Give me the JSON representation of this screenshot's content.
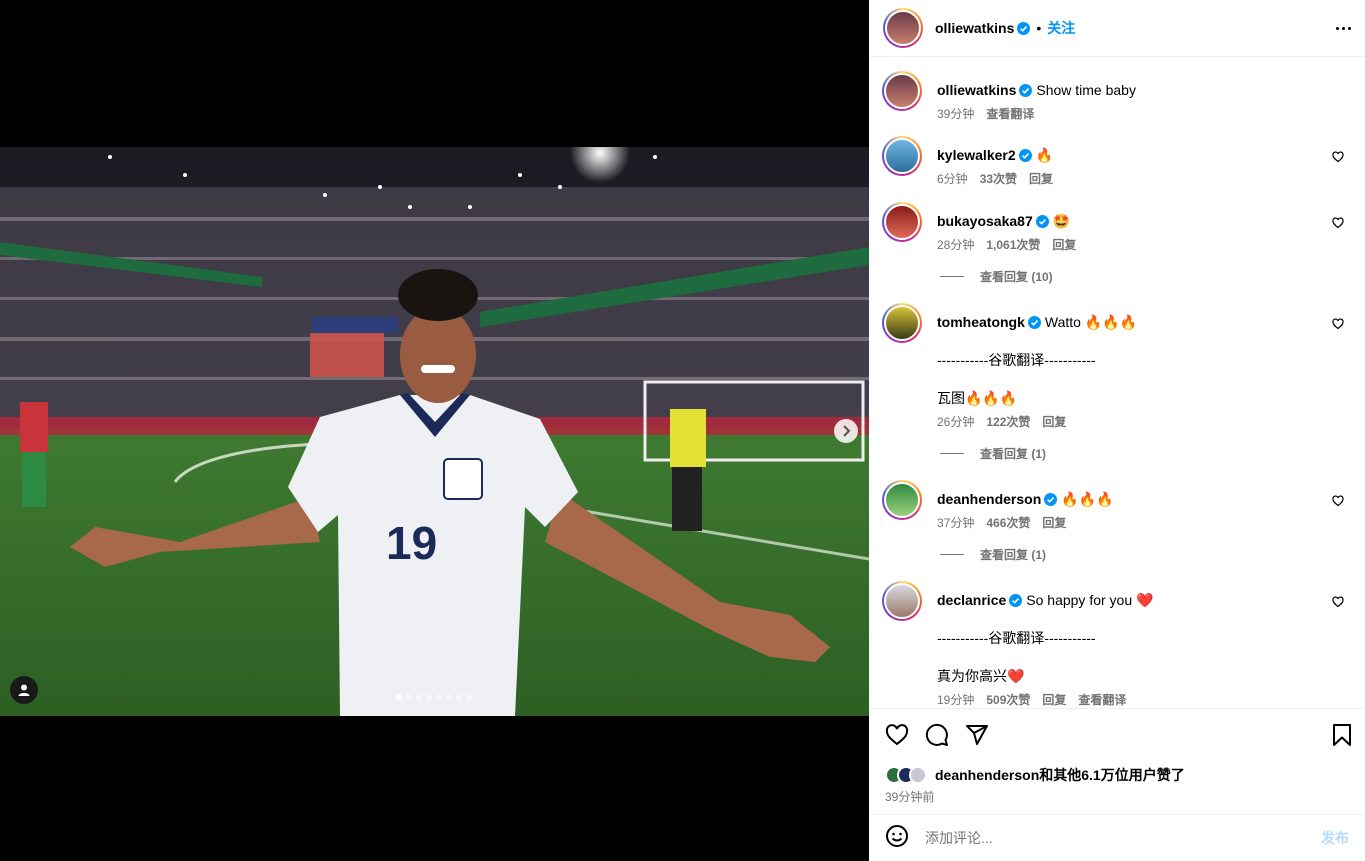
{
  "post": {
    "author": "olliewatkins",
    "follow_label": "关注",
    "separator": "•"
  },
  "media": {
    "slide_count": 8,
    "active_slide": 1
  },
  "comments": [
    {
      "user": "olliewatkins",
      "text": "Show time baby",
      "time": "39分钟",
      "likes": "",
      "actions": [
        "查看翻译"
      ],
      "verified": true
    },
    {
      "user": "kylewalker2",
      "text": "🔥",
      "time": "6分钟",
      "likes": "33次赞",
      "actions": [
        "回复"
      ],
      "verified": true
    },
    {
      "user": "bukayosaka87",
      "text": "🤩",
      "time": "28分钟",
      "likes": "1,061次赞",
      "actions": [
        "回复"
      ],
      "replies": "查看回复 (10)",
      "verified": true
    },
    {
      "user": "tomheatongk",
      "text": "Watto 🔥🔥🔥",
      "translate_label": "-----------谷歌翻译-----------",
      "translation": "瓦图🔥🔥🔥",
      "time": "26分钟",
      "likes": "122次赞",
      "actions": [
        "回复"
      ],
      "replies": "查看回复 (1)",
      "verified": true
    },
    {
      "user": "deanhenderson",
      "text": "🔥🔥🔥",
      "time": "37分钟",
      "likes": "466次赞",
      "actions": [
        "回复"
      ],
      "replies": "查看回复 (1)",
      "verified": true
    },
    {
      "user": "declanrice",
      "text": "So happy for you ❤️",
      "translate_label": "-----------谷歌翻译-----------",
      "translation": "真为你高兴❤️",
      "time": "19分钟",
      "likes": "509次赞",
      "actions": [
        "回复",
        "查看翻译"
      ],
      "verified": true
    }
  ],
  "likes_summary": "deanhenderson和其他6.1万位用户赞了",
  "posted_ago": "39分钟前",
  "comment_input": {
    "placeholder": "添加评论...",
    "post_label": "发布"
  },
  "colors": {
    "link": "#0095f6",
    "muted": "#737373",
    "verified": "#0095f6",
    "post_disabled": "#b3dbff"
  }
}
